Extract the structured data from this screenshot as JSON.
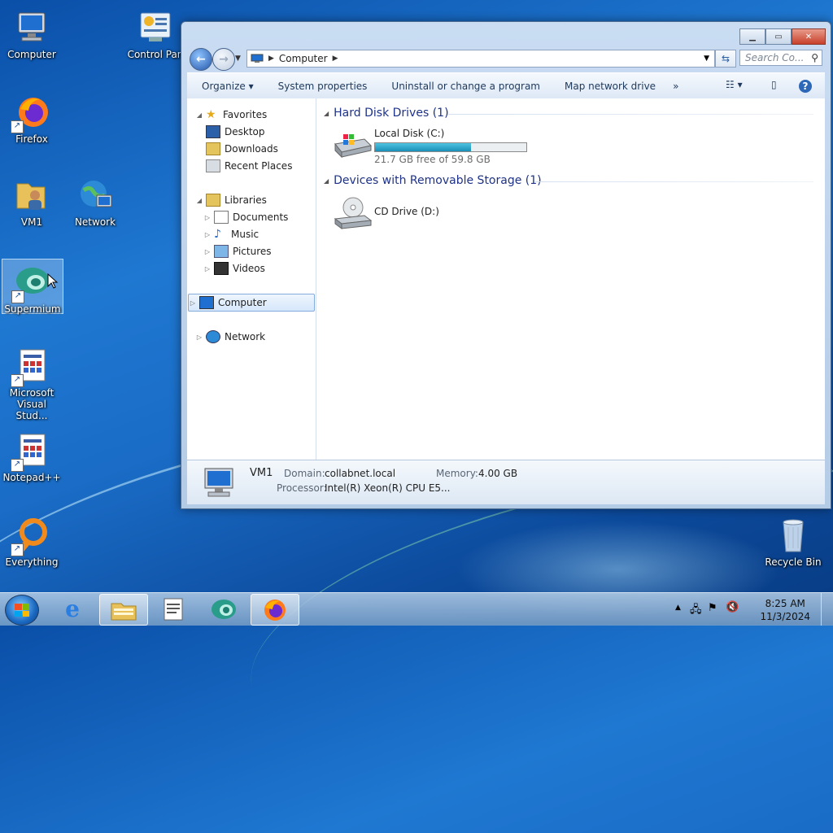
{
  "desktop": {
    "icons": [
      {
        "label": "Computer",
        "icon": "computer-icon"
      },
      {
        "label": "Control Pan",
        "icon": "control-panel-icon"
      },
      {
        "label": "Firefox",
        "icon": "firefox-icon"
      },
      {
        "label": "VM1",
        "icon": "user-folder-icon"
      },
      {
        "label": "Network",
        "icon": "network-icon"
      },
      {
        "label": "Supermium",
        "icon": "supermium-icon"
      },
      {
        "label": "Microsoft Visual Stud...",
        "icon": "visual-studio-icon"
      },
      {
        "label": "Notepad++",
        "icon": "notepadpp-icon"
      },
      {
        "label": "Everything",
        "icon": "everything-icon"
      },
      {
        "label": "Recycle Bin",
        "icon": "recycle-bin-icon"
      }
    ]
  },
  "window": {
    "address": {
      "crumb": "Computer"
    },
    "search_placeholder": "Search Co...",
    "toolbar": {
      "organize": "Organize",
      "system_properties": "System properties",
      "uninstall": "Uninstall or change a program",
      "map_drive": "Map network drive",
      "more": "»"
    },
    "nav": {
      "favorites": "Favorites",
      "desktop": "Desktop",
      "downloads": "Downloads",
      "recent": "Recent Places",
      "libraries": "Libraries",
      "documents": "Documents",
      "music": "Music",
      "pictures": "Pictures",
      "videos": "Videos",
      "computer": "Computer",
      "network": "Network"
    },
    "groups": {
      "hdd": "Hard Disk Drives (1)",
      "removable": "Devices with Removable Storage (1)"
    },
    "drives": {
      "c_name": "Local Disk (C:)",
      "c_free": "21.7 GB free of 59.8 GB",
      "c_used_fraction": 0.637,
      "d_name": "CD Drive (D:)"
    },
    "details": {
      "name": "VM1",
      "domain_label": "Domain:",
      "domain": "collabnet.local",
      "memory_label": "Memory:",
      "memory": "4.00 GB",
      "processor_label": "Processor:",
      "processor": "Intel(R) Xeon(R) CPU E5..."
    }
  },
  "taskbar": {
    "clock_time": "8:25 AM",
    "clock_date": "11/3/2024"
  }
}
